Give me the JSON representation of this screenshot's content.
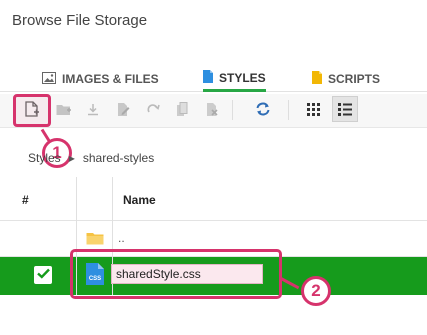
{
  "page": {
    "title": "Browse File Storage"
  },
  "tabs": [
    {
      "label": "IMAGES & FILES",
      "icon": "image-icon"
    },
    {
      "label": "STYLES",
      "icon": "file-icon",
      "active": true
    },
    {
      "label": "SCRIPTS",
      "icon": "file-icon"
    }
  ],
  "toolbar": {
    "buttons": [
      "new-file-icon",
      "new-folder-icon",
      "download-icon",
      "edit-icon",
      "redo-icon",
      "copy-icon",
      "delete-icon",
      "refresh-icon",
      "grid-view-icon",
      "list-view-icon"
    ]
  },
  "breadcrumb": {
    "items": [
      "Styles",
      "shared-styles"
    ]
  },
  "table": {
    "columns": [
      "#",
      "Name"
    ],
    "parent_row": {
      "name": ".."
    },
    "selected_row": {
      "filename": "sharedStyle.css",
      "file_icon_label": "CSS",
      "checked": true
    }
  },
  "annotations": {
    "step1": "1",
    "step2": "2"
  },
  "colors": {
    "accent": "#d6336c",
    "selected_row": "#169b1c",
    "tab_active": "#28a745",
    "refresh": "#2f6db5"
  }
}
